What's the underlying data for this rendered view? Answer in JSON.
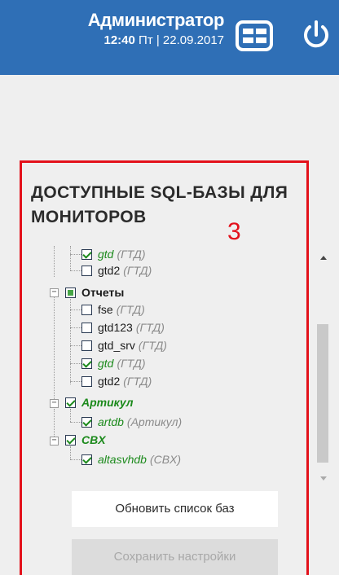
{
  "header": {
    "user_name": "Администратор",
    "time": "12:40",
    "datetime_rest": " Пт | 22.09.2017",
    "bg_color": "#2f6fb6"
  },
  "panel": {
    "title": "ДОСТУПНЫЕ SQL-БАЗЫ ДЛЯ МОНИТОРОВ",
    "annotation_number": "3",
    "border_color": "#e3111b"
  },
  "tree": {
    "items": [
      {
        "name": "gtd",
        "type": "(ГТД)",
        "checked": true,
        "green": true
      },
      {
        "name": "gtd2",
        "type": "(ГТД)",
        "checked": false,
        "green": false
      },
      {
        "name": "Отчеты",
        "type": "",
        "state": "partial",
        "bold": true
      },
      {
        "name": "fse",
        "type": "(ГТД)",
        "checked": false,
        "green": false
      },
      {
        "name": "gtd123",
        "type": "(ГТД)",
        "checked": false,
        "green": false
      },
      {
        "name": "gtd_srv",
        "type": "(ГТД)",
        "checked": false,
        "green": false
      },
      {
        "name": "gtd",
        "type": "(ГТД)",
        "checked": true,
        "green": true
      },
      {
        "name": "gtd2",
        "type": "(ГТД)",
        "checked": false,
        "green": false
      },
      {
        "name": "Артикул",
        "type": "",
        "checked": true,
        "green": true,
        "bold": true
      },
      {
        "name": "artdb",
        "type": "(Артикул)",
        "checked": true,
        "green": true
      },
      {
        "name": "CBX",
        "type": "",
        "checked": true,
        "green": true,
        "bold": true
      },
      {
        "name": "altasvhdb",
        "type": "(CBX)",
        "checked": true,
        "green": true
      }
    ]
  },
  "buttons": {
    "refresh_label": "Обновить список баз",
    "save_label": "Сохранить настройки"
  },
  "icons": {
    "menu": "grid-menu-icon",
    "power": "power-icon",
    "expander": "minus-expander-icon"
  }
}
